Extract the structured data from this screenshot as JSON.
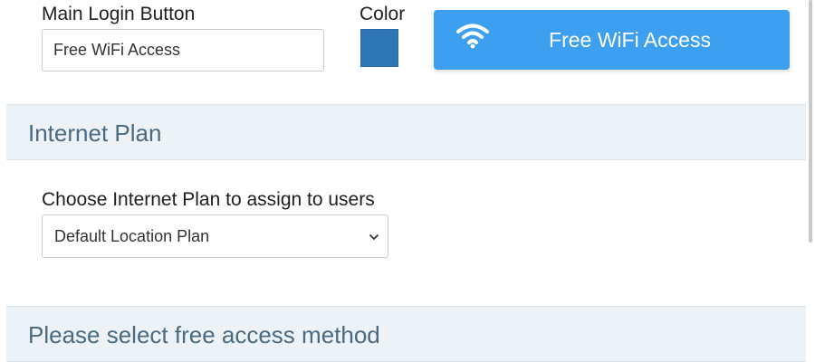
{
  "login_button": {
    "label": "Main Login Button",
    "value": "Free WiFi Access"
  },
  "color": {
    "label": "Color",
    "value": "#2e75b6"
  },
  "preview_button": {
    "label": "Free WiFi Access",
    "icon": "wifi-icon",
    "background": "#3d9ff0"
  },
  "internet_plan": {
    "title": "Internet Plan",
    "choose_label": "Choose Internet Plan to assign to users",
    "selected": "Default Location Plan"
  },
  "free_access": {
    "title": "Please select free access method"
  }
}
